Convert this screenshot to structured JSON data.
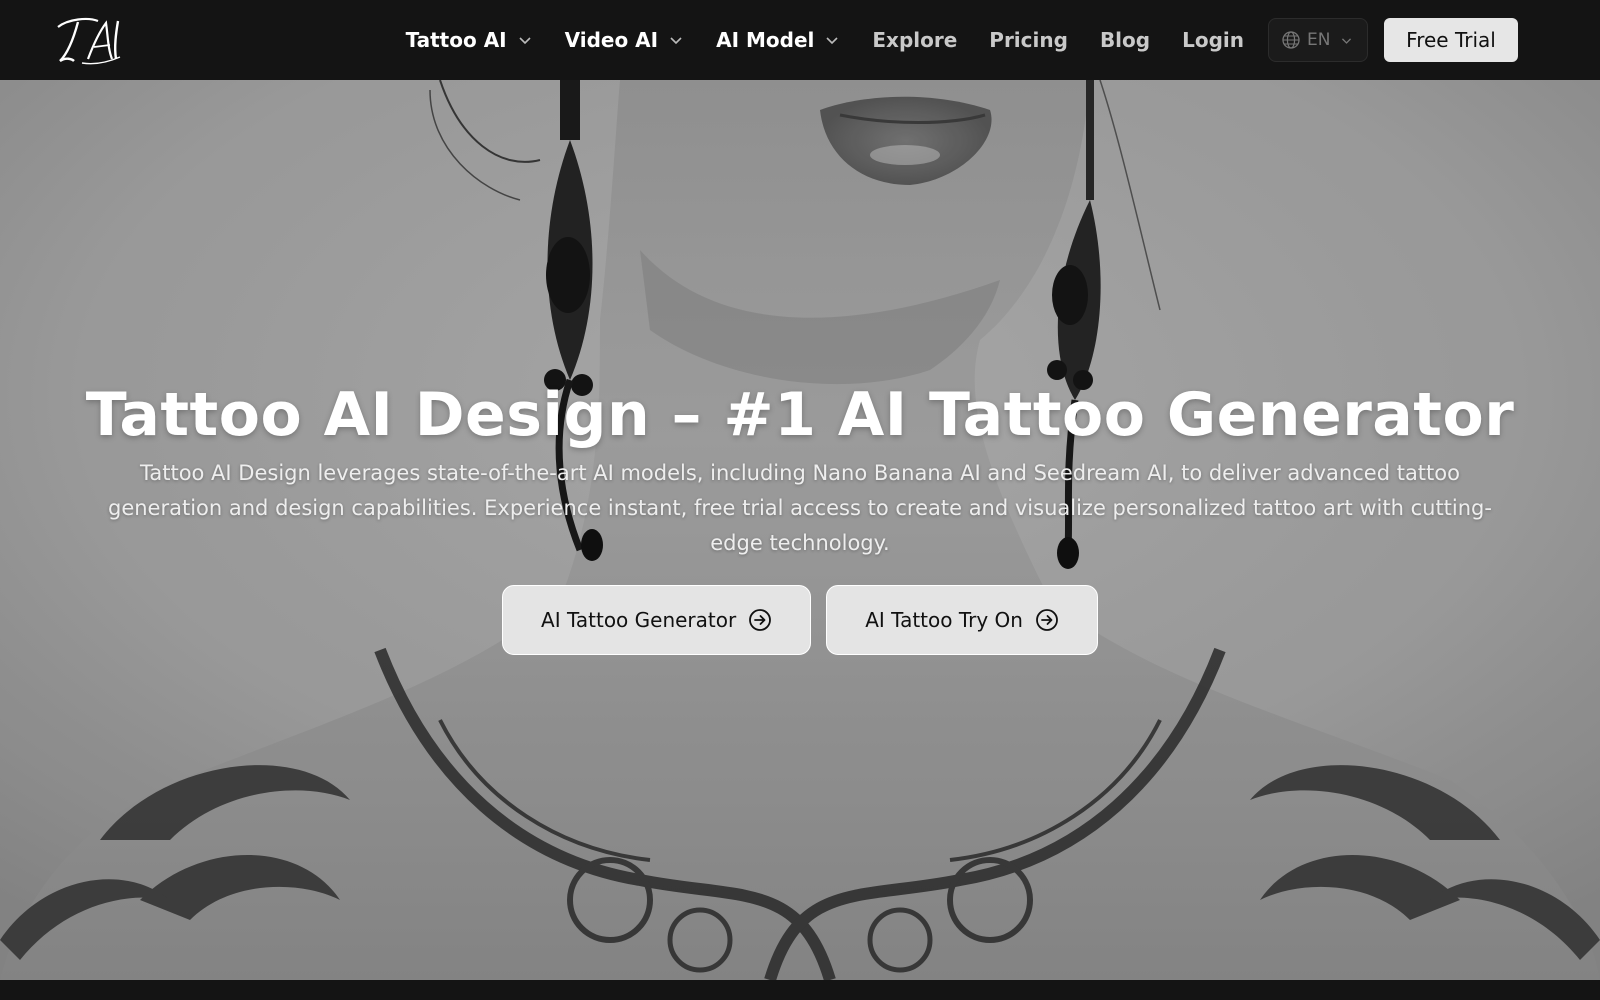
{
  "brand": {
    "logo_text": "TAI"
  },
  "nav": {
    "items": [
      {
        "label": "Tattoo AI",
        "dropdown": true
      },
      {
        "label": "Video AI",
        "dropdown": true
      },
      {
        "label": "AI Model",
        "dropdown": true
      },
      {
        "label": "Explore",
        "dropdown": false
      },
      {
        "label": "Pricing",
        "dropdown": false
      },
      {
        "label": "Blog",
        "dropdown": false
      },
      {
        "label": "Login",
        "dropdown": false
      }
    ],
    "language": "EN",
    "cta_label": "Free Trial"
  },
  "hero": {
    "title": "Tattoo AI Design – #1 AI Tattoo Generator",
    "description": "Tattoo AI Design leverages state-of-the-art AI models, including Nano Banana AI and Seedream AI, to deliver advanced tattoo generation and design capabilities. Experience instant, free trial access to create and visualize personalized tattoo art with cutting-edge technology.",
    "buttons": [
      {
        "label": "AI Tattoo Generator",
        "icon": "arrow-circle-right-icon"
      },
      {
        "label": "AI Tattoo Try On",
        "icon": "arrow-circle-right-icon"
      }
    ]
  },
  "colors": {
    "nav_bg": "#141414",
    "nav_text": "#ffffff",
    "nav_muted": "#c9c9c9",
    "button_bg": "#e4e4e4",
    "hero_tone": "grayscale"
  }
}
